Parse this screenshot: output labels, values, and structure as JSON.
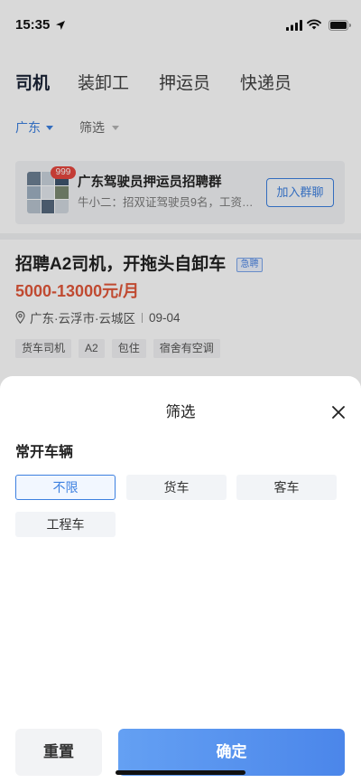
{
  "status_bar": {
    "time": "15:35"
  },
  "tabs": [
    {
      "label": "司机",
      "selected": true
    },
    {
      "label": "装卸工",
      "selected": false
    },
    {
      "label": "押运员",
      "selected": false
    },
    {
      "label": "快递员",
      "selected": false
    }
  ],
  "filters": {
    "region": "广东",
    "filter": "筛选"
  },
  "group_card": {
    "badge": "999",
    "title": "广东驾驶员押运员招聘群",
    "subtitle": "牛小二：招双证驾驶员9名，工资…",
    "join_label": "加入群聊"
  },
  "job": {
    "title": "招聘A2司机，开拖头自卸车",
    "urgent_tag": "急聘",
    "salary": "5000-13000元/月",
    "location": "广东·云浮市·云城区",
    "date": "09-04",
    "tags": [
      "货车司机",
      "A2",
      "包住",
      "宿舍有空调"
    ]
  },
  "sheet": {
    "title": "筛选",
    "section_label": "常开车辆",
    "options": [
      {
        "label": "不限",
        "selected": true
      },
      {
        "label": "货车",
        "selected": false
      },
      {
        "label": "客车",
        "selected": false
      },
      {
        "label": "工程车",
        "selected": false
      }
    ],
    "reset_label": "重置",
    "confirm_label": "确定"
  },
  "icons": {
    "status_location": "location-arrow-icon",
    "status_signal": "cellular-signal-icon",
    "status_wifi": "wifi-icon",
    "status_battery": "battery-icon",
    "filter_caret": "caret-down-icon",
    "job_location": "map-pin-icon",
    "sheet_close": "close-icon"
  },
  "colors": {
    "accent": "#3d80e0",
    "salary": "#e2573a",
    "badge": "#e5473f",
    "confirm_start": "#64a0f3",
    "confirm_end": "#4b86ea"
  }
}
